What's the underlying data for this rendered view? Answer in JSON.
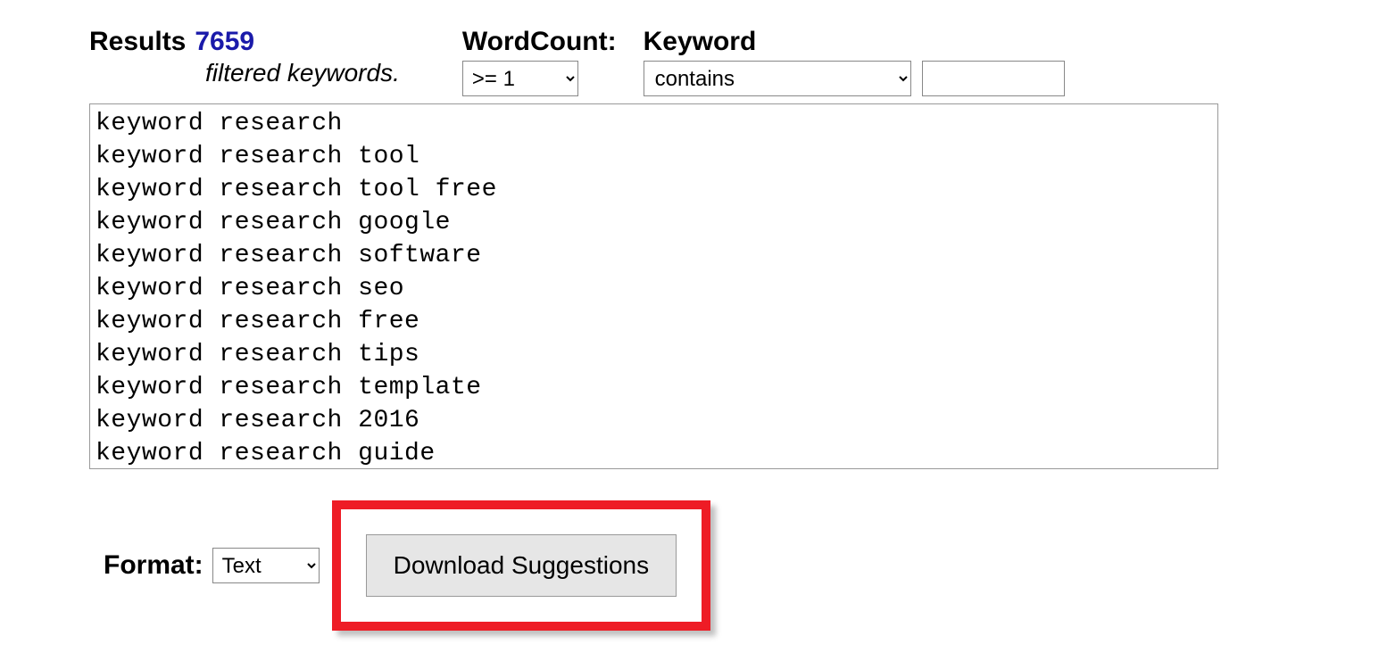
{
  "header": {
    "results_label": "Results",
    "results_count": "7659",
    "filtered_text": "filtered keywords.",
    "wordcount_label": "WordCount:",
    "wordcount_selected": ">= 1",
    "keyword_label": "Keyword",
    "keyword_filter_selected": "contains",
    "keyword_input_value": ""
  },
  "results": {
    "text": "keyword research\nkeyword research tool\nkeyword research tool free\nkeyword research google\nkeyword research software\nkeyword research seo\nkeyword research free\nkeyword research tips\nkeyword research template\nkeyword research 2016\nkeyword research guide"
  },
  "footer": {
    "format_label": "Format:",
    "format_selected": "Text",
    "download_label": "Download Suggestions"
  }
}
